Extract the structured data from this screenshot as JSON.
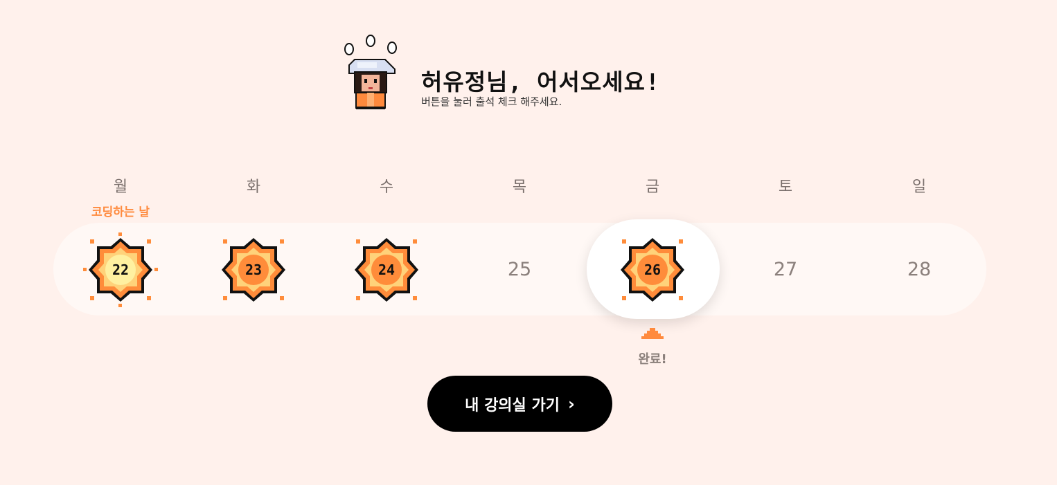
{
  "header": {
    "greeting": "허유정님, 어서오세요!",
    "subtext": "버튼을 눌러 출석 체크 해주세요."
  },
  "weekdays": [
    "월",
    "화",
    "수",
    "목",
    "금",
    "토",
    "일"
  ],
  "special_label": "코딩하는 날",
  "days": [
    {
      "num": "22",
      "attended": true,
      "highlight": true
    },
    {
      "num": "23",
      "attended": true
    },
    {
      "num": "24",
      "attended": true
    },
    {
      "num": "25",
      "attended": false
    },
    {
      "num": "26",
      "attended": true,
      "today": true
    },
    {
      "num": "27",
      "attended": false
    },
    {
      "num": "28",
      "attended": false
    }
  ],
  "today_status": "완료!",
  "cta": {
    "label": "내 강의실 가기",
    "icon": "chevron-right-icon"
  },
  "colors": {
    "background": "#fff1ec",
    "accent": "#ff8a3d",
    "sun_fill": "#ff8c3a",
    "sun_highlight": "#fff0a0"
  }
}
